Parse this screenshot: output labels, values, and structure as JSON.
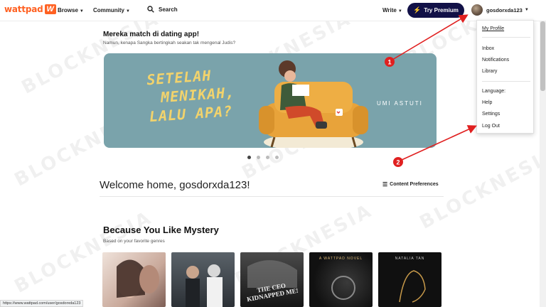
{
  "nav": {
    "logo": "wattpad",
    "browse": "Browse",
    "community": "Community",
    "search": "Search",
    "write": "Write",
    "premium": "Try Premium",
    "username": "gosdorxda123"
  },
  "hero": {
    "title": "Mereka match di dating app!",
    "subtitle": "Namun, kenapa Sangka bertingkah seakan tak mengenal Judis?",
    "banner_line1": "SETELAH",
    "banner_line2": "MENIKAH,",
    "banner_line3": "LALU APA?",
    "banner_author": "UMI ASTUTI"
  },
  "welcome": {
    "text": "Welcome home, gosdorxda123!",
    "preferences": "Content Preferences"
  },
  "section": {
    "title": "Because You Like Mystery",
    "subtitle": "Based on your favorite genres",
    "covers": [
      {
        "label": "",
        "title": "",
        "color": "#e8d7cf"
      },
      {
        "label": "",
        "title": "",
        "color": "#3b4248"
      },
      {
        "label": "",
        "title": "THE CEO KIDNAPPED ME!",
        "color": "#2c2c2c"
      },
      {
        "label": "A WATTPAD NOVEL",
        "title": "",
        "color": "#1c1c1c"
      },
      {
        "label": "NATALIA TAN",
        "title": "",
        "color": "#121212"
      }
    ]
  },
  "dropdown": {
    "my_profile": "My Profile",
    "inbox": "Inbox",
    "notifications": "Notifications",
    "library": "Library",
    "language": "Language:",
    "help": "Help",
    "settings": "Settings",
    "logout": "Log Out"
  },
  "annotations": {
    "marker1": "1",
    "marker2": "2",
    "color": "#e02020"
  },
  "watermark": "BLOCKNESIA",
  "status_url": "https://www.wattpad.com/user/gosdorxda123"
}
